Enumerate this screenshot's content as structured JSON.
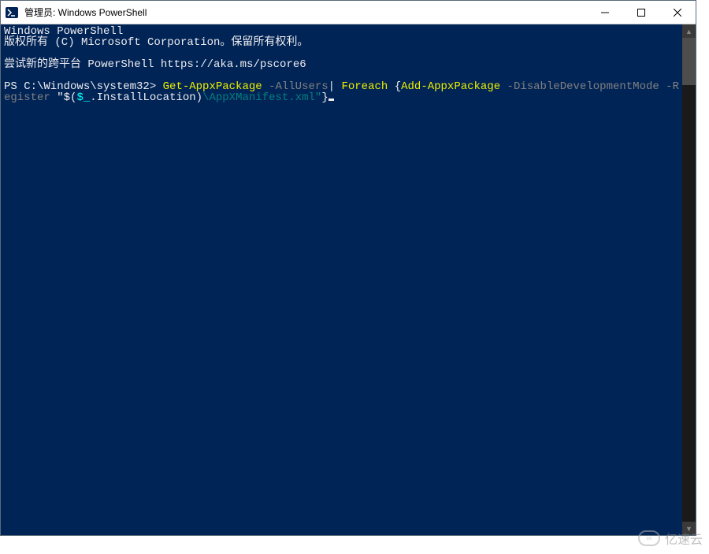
{
  "window": {
    "title": "管理员: Windows PowerShell"
  },
  "terminal": {
    "header1": "Windows PowerShell",
    "header2": "版权所有 (C) Microsoft Corporation。保留所有权利。",
    "try_line": "尝试新的跨平台 PowerShell https://aka.ms/pscore6",
    "prompt": "PS C:\\Windows\\system32>",
    "cmd": {
      "p1": " Get-AppxPackage",
      "p2": " -AllUsers",
      "p3": "|",
      "p4": " Foreach ",
      "p5": "{",
      "p6": "Add-AppxPackage",
      "p7": " -DisableDevelopmentMode -Register ",
      "p8": "\"$(",
      "p9": "$_",
      "p10": ".InstallLocation",
      "p11": ")",
      "p12": "\\AppXManifest.xml\"",
      "p13": "}"
    }
  },
  "watermark": {
    "text": "亿速云"
  }
}
